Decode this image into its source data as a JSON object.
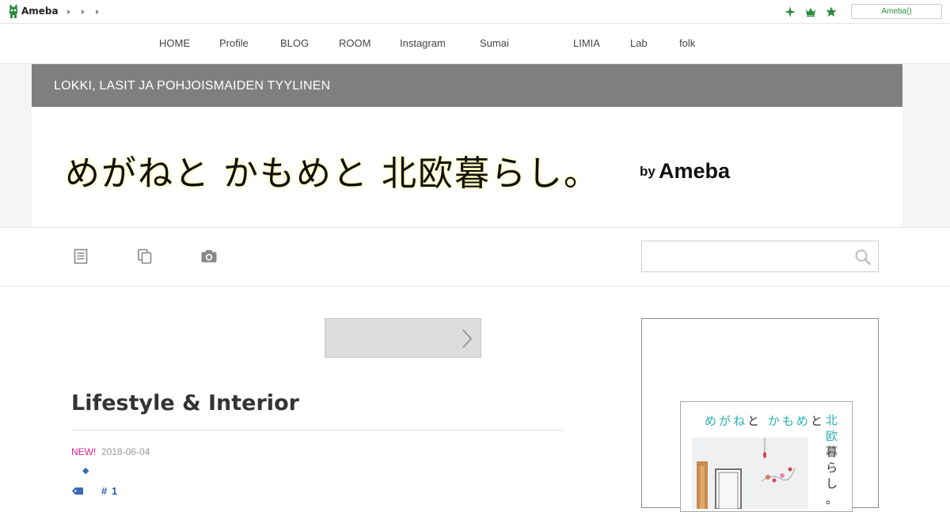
{
  "topbar": {
    "logo_text": "Ameba",
    "login_label": "Ameba()",
    "icons": [
      "sparkle-icon",
      "crown-icon",
      "star-icon"
    ],
    "accent": "#2d8c3c"
  },
  "nav": {
    "items": [
      {
        "label": "HOME"
      },
      {
        "label": "Profile"
      },
      {
        "label": "BLOG"
      },
      {
        "label": "ROOM"
      },
      {
        "label": "Instagram"
      },
      {
        "label": "Sumai"
      },
      {
        "label": "LIMIA"
      },
      {
        "label": "Lab"
      },
      {
        "label": "folk"
      }
    ]
  },
  "header": {
    "subtitle": "LOKKI, LASIT JA POHJOISMAIDEN TYYLINEN",
    "title": "めがねと かもめと 北欧暮らし。",
    "by": "by",
    "brand": "Ameba",
    "strip_color": "#7f7f7f"
  },
  "toolbar": {
    "icons": [
      "entry-list-icon",
      "theme-list-icon",
      "camera-icon"
    ],
    "search_placeholder": ""
  },
  "entry": {
    "title": "Lifestyle & Interior",
    "new_badge": "NEW!",
    "date": "2018-06-04",
    "diamond": "◆",
    "hashtag": "# 1"
  },
  "sidebar": {
    "book": {
      "title_a": "めがね",
      "title_b": "と",
      "title_c": "かもめ",
      "title_d": "と",
      "vertical": [
        "北",
        "欧",
        "暮",
        "ら",
        "し",
        "。"
      ]
    }
  }
}
